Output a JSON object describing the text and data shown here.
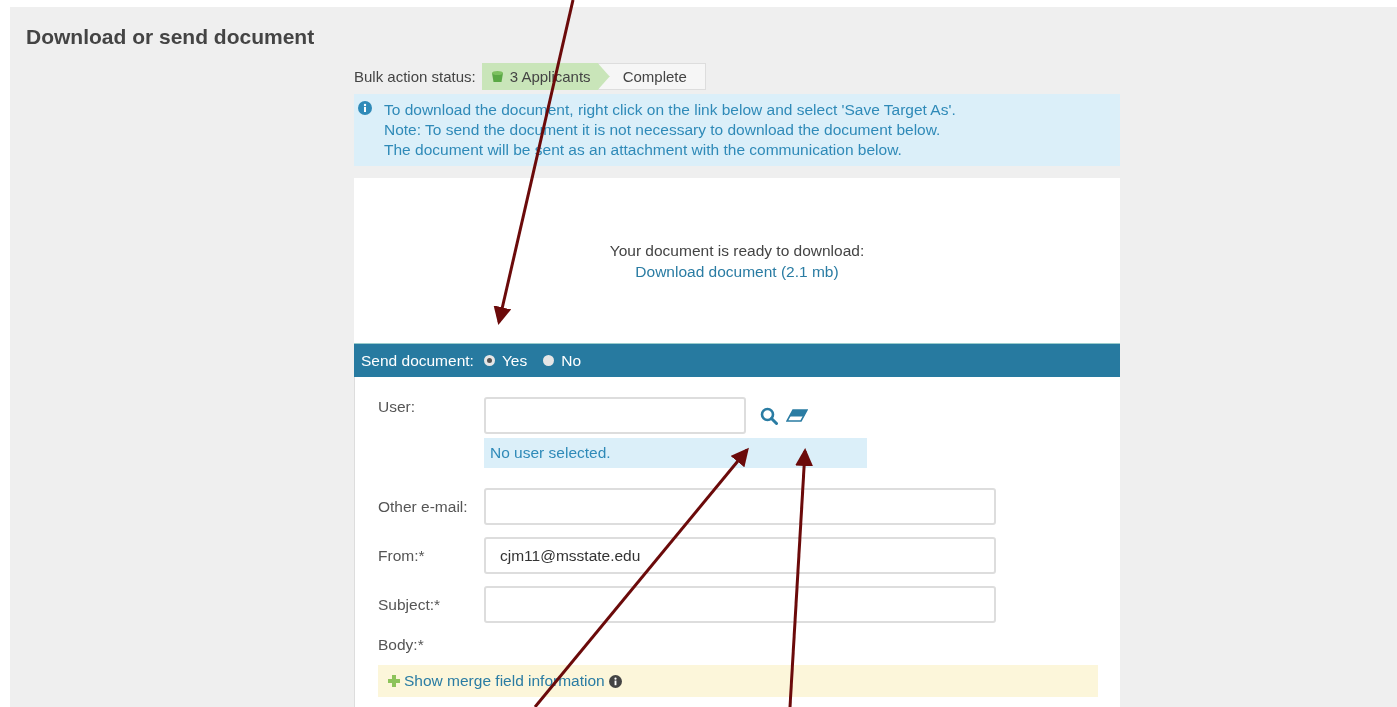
{
  "page": {
    "title": "Download or send document"
  },
  "bulk_status": {
    "label": "Bulk action status:",
    "steps": [
      {
        "label": "3 Applicants",
        "selected": true
      },
      {
        "label": "Complete",
        "selected": false
      }
    ]
  },
  "info": {
    "lines": [
      "To download the document, right click on the link below and select 'Save Target As'.",
      "Note: To send the document it is not necessary to download the document below.",
      "The document will be sent as an attachment with the communication below."
    ]
  },
  "download": {
    "message": "Your document is ready to download:",
    "link": "Download document (2.1 mb)"
  },
  "send": {
    "label": "Send document:",
    "options": [
      {
        "label": "Yes",
        "selected": true
      },
      {
        "label": "No",
        "selected": false
      }
    ]
  },
  "form": {
    "fields": [
      {
        "kind": "user",
        "label": "User:",
        "status": "No user selected."
      },
      {
        "kind": "text",
        "label": "Other e-mail:"
      },
      {
        "kind": "text",
        "label": "From:*",
        "value": "cjm11@msstate.edu"
      },
      {
        "kind": "text",
        "label": "Subject:*"
      },
      {
        "kind": "body",
        "label": "Body:*",
        "merge_link": "Show merge field information"
      }
    ]
  }
}
